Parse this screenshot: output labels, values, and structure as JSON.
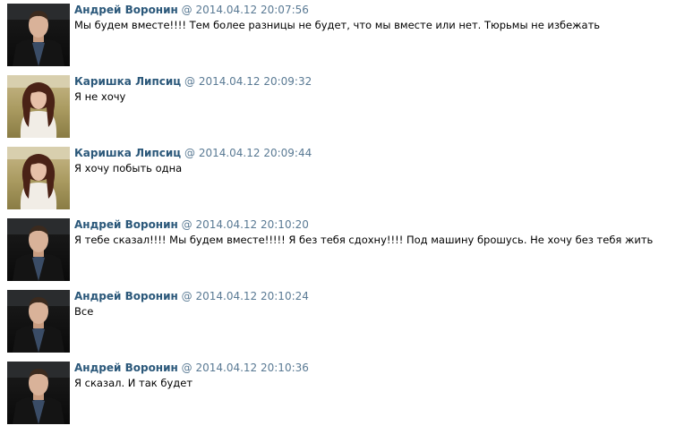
{
  "messages": [
    {
      "author": "Андрей Воронин",
      "sep": "@",
      "datetime": "2014.04.12 20:07:56",
      "text": "Мы будем вместе!!!! Тем более разницы не будет, что мы вместе или нет. Тюрьмы не избежать",
      "avatar": "andrey"
    },
    {
      "author": "Каришка Липсиц",
      "sep": "@",
      "datetime": "2014.04.12 20:09:32",
      "text": "Я не хочу",
      "avatar": "karishka"
    },
    {
      "author": "Каришка Липсиц",
      "sep": "@",
      "datetime": "2014.04.12 20:09:44",
      "text": "Я хочу побыть одна",
      "avatar": "karishka"
    },
    {
      "author": "Андрей Воронин",
      "sep": "@",
      "datetime": "2014.04.12 20:10:20",
      "text": "Я тебе сказал!!!! Мы будем вместе!!!!! Я без тебя сдохну!!!! Под машину брошусь. Не хочу без тебя жить",
      "avatar": "andrey"
    },
    {
      "author": "Андрей Воронин",
      "sep": "@",
      "datetime": "2014.04.12 20:10:24",
      "text": "Все",
      "avatar": "andrey"
    },
    {
      "author": "Андрей Воронин",
      "sep": "@",
      "datetime": "2014.04.12 20:10:36",
      "text": "Я сказал. И так будет",
      "avatar": "andrey"
    }
  ],
  "colors": {
    "author": "#2b587a",
    "meta": "#5a7a94",
    "text": "#000000"
  }
}
